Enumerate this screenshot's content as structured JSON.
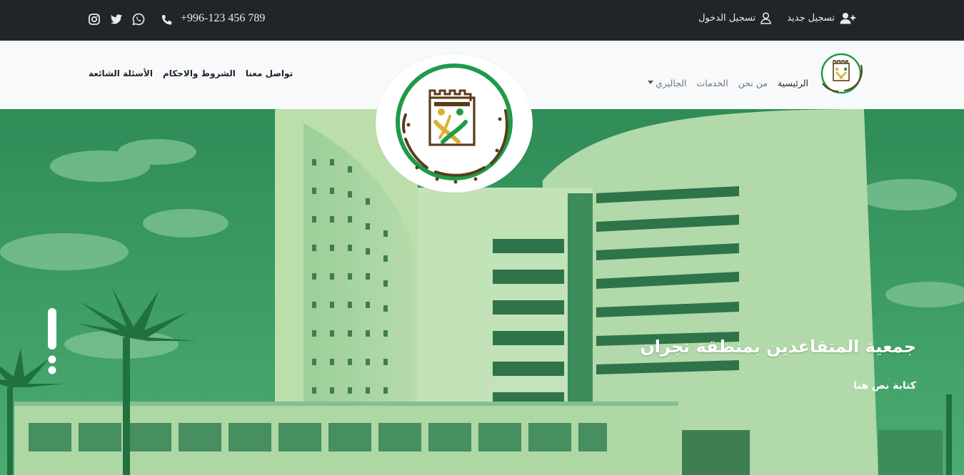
{
  "topbar": {
    "social": [
      {
        "icon": "instagram-icon"
      },
      {
        "icon": "twitter-icon"
      },
      {
        "icon": "whatsapp-icon"
      }
    ],
    "phone_icon": "phone-icon",
    "phone": "+996-123 456 789",
    "login_label": "تسجيل الدخول",
    "login_icon": "user-icon",
    "register_label": "تسجيل جديد",
    "register_icon": "user-plus-icon"
  },
  "nav": {
    "right_links": [
      {
        "label": "الرئيسية",
        "active": true
      },
      {
        "label": "من نحن"
      },
      {
        "label": "الخدمات"
      },
      {
        "label": "الجاليري",
        "dropdown": true
      }
    ],
    "left_links": [
      {
        "label": "الأسئلة الشائعة"
      },
      {
        "label": "الشروط والاحكام"
      },
      {
        "label": "تواصل معنا"
      }
    ]
  },
  "logo": {
    "text": "جمعية المتقاعدين بمنطقة نجران",
    "colors": {
      "green": "#1f9a4a",
      "brown": "#5a3d1a",
      "gold": "#d8b22e"
    }
  },
  "hero": {
    "title": "جمعية المتقاعدين بمنطقة نجران",
    "subtitle": "كتابة نص هنا",
    "overlay_color": "#2f9e5d"
  },
  "colors": {
    "topbar_bg": "#212529",
    "navbar_bg": "#f8f9fa"
  }
}
